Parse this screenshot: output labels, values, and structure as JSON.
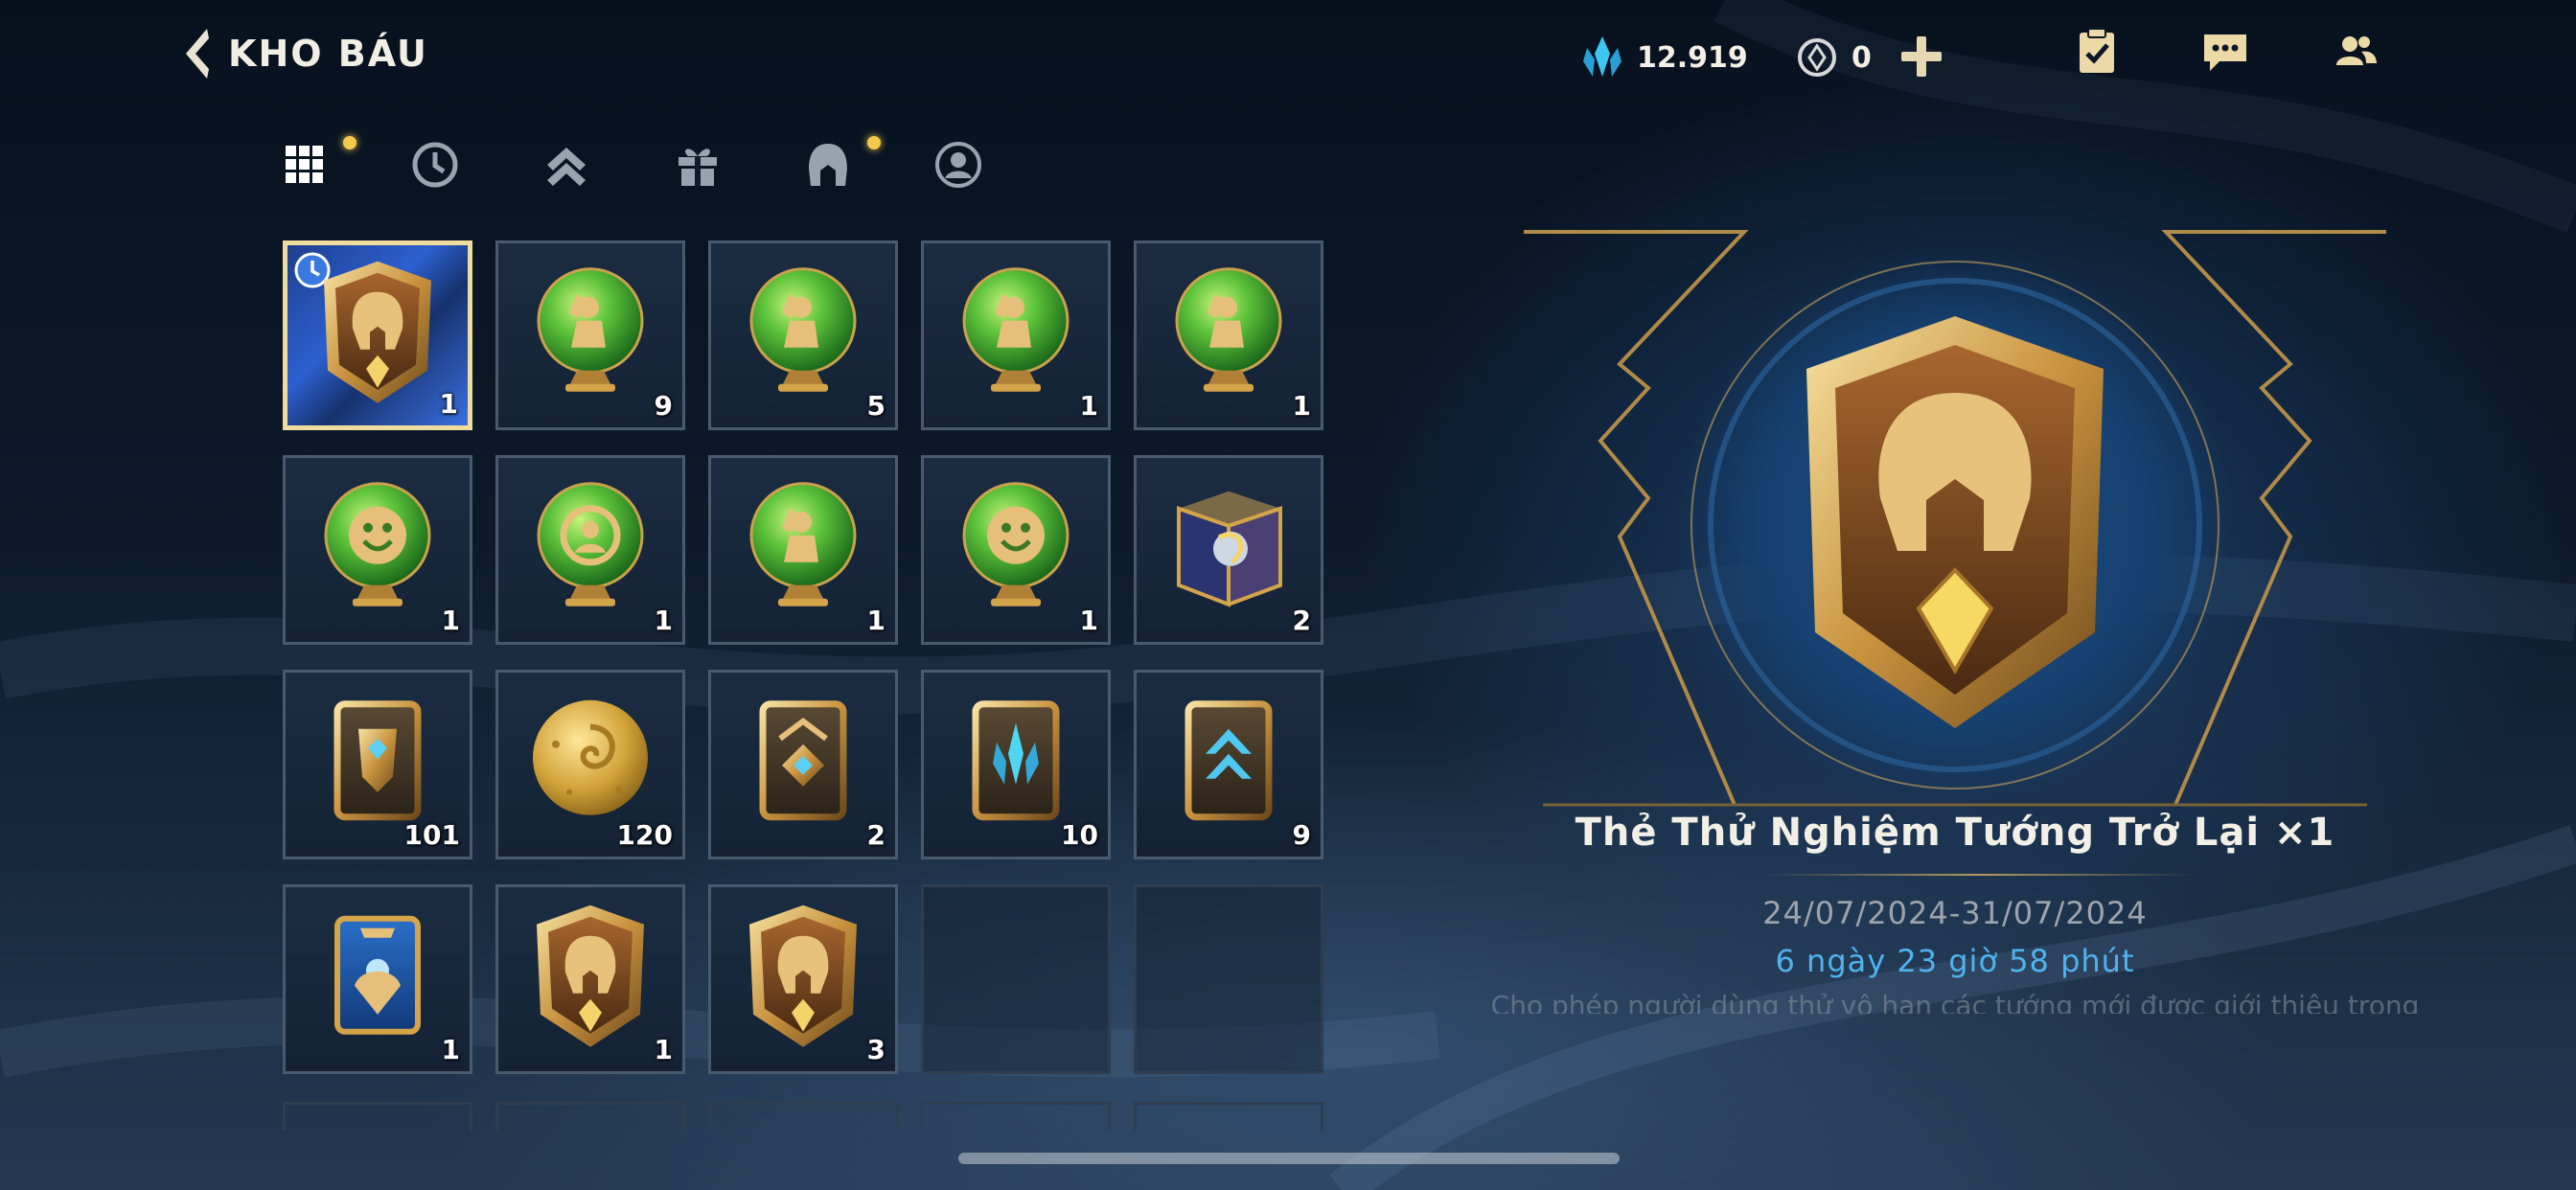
{
  "header": {
    "title": "KHO BÁU",
    "gem_amount": "12.919",
    "coin_amount": "0"
  },
  "colors": {
    "gold": "#d8b468",
    "accent_blue": "#4fb3ee",
    "notify_dot": "#f2c94c"
  },
  "tabs": [
    {
      "icon": "grid-icon",
      "active": true,
      "dot": true
    },
    {
      "icon": "clock-icon",
      "active": false,
      "dot": false
    },
    {
      "icon": "rank-up-icon",
      "active": false,
      "dot": false
    },
    {
      "icon": "gift-icon",
      "active": false,
      "dot": false
    },
    {
      "icon": "helmet-icon",
      "active": false,
      "dot": true
    },
    {
      "icon": "profile-icon",
      "active": false,
      "dot": false
    }
  ],
  "items": [
    {
      "icon": "trial-card-icon",
      "count": "1",
      "selected": true
    },
    {
      "icon": "green-orb-wave-icon",
      "count": "9"
    },
    {
      "icon": "green-orb-wave-icon",
      "count": "5"
    },
    {
      "icon": "green-orb-wave-icon",
      "count": "1"
    },
    {
      "icon": "green-orb-wave-icon",
      "count": "1"
    },
    {
      "icon": "green-orb-smile-icon",
      "count": "1"
    },
    {
      "icon": "green-orb-avatar-icon",
      "count": "1"
    },
    {
      "icon": "green-orb-wave-icon",
      "count": "1"
    },
    {
      "icon": "green-orb-smile-icon",
      "count": "1"
    },
    {
      "icon": "mystery-chest-icon",
      "count": "2"
    },
    {
      "icon": "gold-emblem-card-icon",
      "count": "101"
    },
    {
      "icon": "gold-coin-icon",
      "count": "120"
    },
    {
      "icon": "rank-card-icon",
      "count": "2"
    },
    {
      "icon": "crystal-card-icon",
      "count": "10"
    },
    {
      "icon": "blue-arrow-card-icon",
      "count": "9"
    },
    {
      "icon": "blue-emblem-card-icon",
      "count": "1"
    },
    {
      "icon": "trial-card-icon",
      "count": "1"
    },
    {
      "icon": "trial-card-icon",
      "count": "3"
    }
  ],
  "detail": {
    "name": "Thẻ Thử Nghiệm Tướng Trở Lại ×1",
    "date_range": "24/07/2024-31/07/2024",
    "remaining": "6 ngày 23 giờ 58 phút",
    "description": "Cho phép người dùng thử vô hạn các tướng mới được giới thiệu trong"
  }
}
